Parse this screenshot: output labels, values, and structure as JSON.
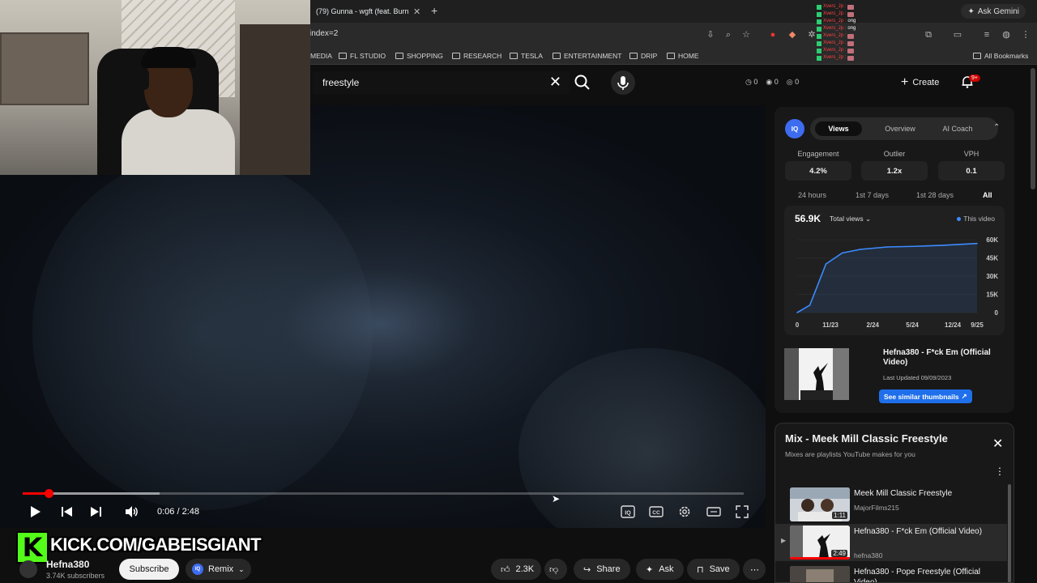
{
  "browser": {
    "tab_title": "(79) Gunna - wgft (feat. Burn",
    "url": "index=2",
    "gemini_label": "Ask Gemini",
    "bookmarks": [
      "MEDIA",
      "FL STUDIO",
      "SHOPPING",
      "RESEARCH",
      "TESLA",
      "ENTERTAINMENT",
      "DRIP",
      "HOME"
    ],
    "all_bookmarks": "All Bookmarks"
  },
  "chat": [
    {
      "user": "Xvers_Jp",
      "msg": ""
    },
    {
      "user": "Xvers_Jp",
      "msg": ""
    },
    {
      "user": "Xvers_Jp",
      "msg": "ong"
    },
    {
      "user": "Xvers_Jp",
      "msg": "ong"
    },
    {
      "user": "Xvers_Jp",
      "msg": ""
    },
    {
      "user": "Xvers_Jp",
      "msg": ""
    },
    {
      "user": "Xvers_Jp",
      "msg": ""
    },
    {
      "user": "Xvers_Jp",
      "msg": ""
    }
  ],
  "header": {
    "search_value": "freestyle",
    "stats": [
      "0",
      "0",
      "0"
    ],
    "create_label": "Create",
    "notif_count": "9+"
  },
  "player": {
    "time": "0:06 / 2:48",
    "played_fraction": 0.036,
    "buffered_fraction": 0.19
  },
  "overlay": {
    "kick_text": "KICK.COM/GABEISGIANT"
  },
  "channel": {
    "name": "Hefna380",
    "subs": "3.74K subscribers",
    "subscribe_label": "Subscribe",
    "remix_label": "Remix",
    "like_count": "2.3K",
    "share_label": "Share",
    "ask_label": "Ask",
    "save_label": "Save"
  },
  "iq": {
    "logo": "IQ",
    "tabs": [
      "Views",
      "Overview",
      "AI Coach"
    ],
    "metrics": [
      {
        "label": "Engagement",
        "value": "4.2%"
      },
      {
        "label": "Outlier",
        "value": "1.2x"
      },
      {
        "label": "VPH",
        "value": "0.1"
      }
    ],
    "ranges": [
      "24 hours",
      "1st 7 days",
      "1st 28 days",
      "All"
    ],
    "total": "56.9K",
    "total_selector": "Total views",
    "legend": "This video",
    "video_title": "Hefna380 - F*ck Em (Official Video)",
    "updated": "Last Updated 09/09/2023",
    "similar_label": "See similar thumbnails"
  },
  "chart_data": {
    "type": "line",
    "x_ticks": [
      "0",
      "11/23",
      "2/24",
      "5/24",
      "12/24",
      "9/25"
    ],
    "y_ticks": [
      "60K",
      "45K",
      "30K",
      "15K",
      "0"
    ],
    "ylim": [
      0,
      60000
    ],
    "series": [
      {
        "name": "This video",
        "x": [
          0,
          0.07,
          0.16,
          0.25,
          0.35,
          0.5,
          0.65,
          0.8,
          1.0
        ],
        "values": [
          0,
          6000,
          40000,
          49000,
          52000,
          54000,
          54500,
          55300,
          56900
        ]
      }
    ],
    "color": "#3d8bff"
  },
  "mix": {
    "title": "Mix - Meek Mill Classic Freestyle",
    "subtitle": "Mixes are playlists YouTube makes for you",
    "items": [
      {
        "title": "Meek Mill Classic Freestyle",
        "channel": "MajorFilms215",
        "duration": "1:11"
      },
      {
        "title": "Hefna380 - F*ck Em (Official Video)",
        "channel": "hefna380",
        "duration": "2:49"
      },
      {
        "title": "Hefna380 - Pope Freestyle (Official Video)",
        "channel": "",
        "duration": ""
      }
    ]
  }
}
